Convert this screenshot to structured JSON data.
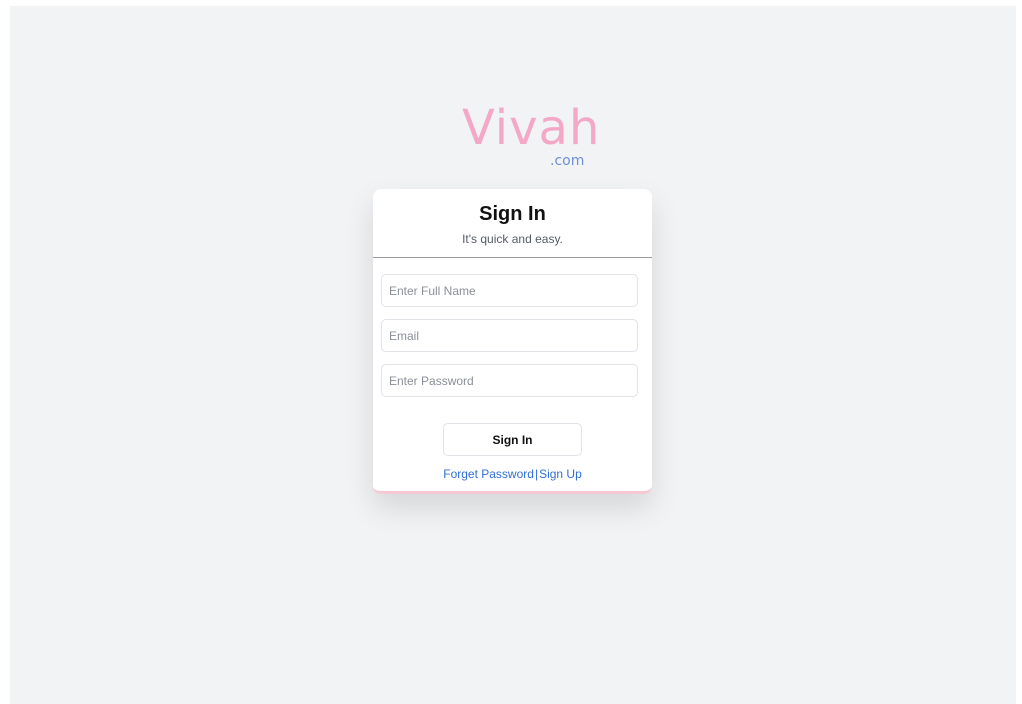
{
  "brand": {
    "name": "Vivah",
    "suffix": ".com",
    "primary_color": "#f4a8c7",
    "suffix_color": "#6f8fd6"
  },
  "card": {
    "title": "Sign In",
    "subtitle": "It's quick and easy."
  },
  "form": {
    "full_name_placeholder": "Enter Full Name",
    "email_placeholder": "Email",
    "password_placeholder": "Enter Password",
    "full_name_value": "",
    "email_value": "",
    "password_value": ""
  },
  "actions": {
    "submit_label": "Sign In",
    "forget_password_label": "Forget Password",
    "separator": "|",
    "sign_up_label": "Sign Up",
    "link_color": "#2f6fd6"
  }
}
